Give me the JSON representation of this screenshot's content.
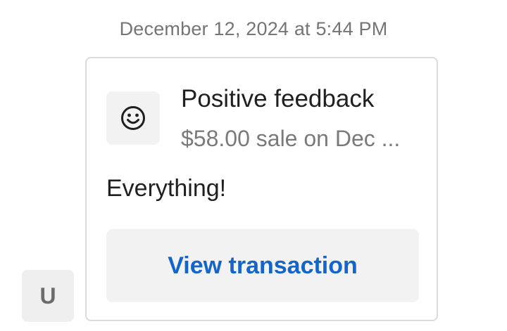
{
  "timestamp": "December 12, 2024 at 5:44 PM",
  "sender": {
    "avatar_initial": "U"
  },
  "card": {
    "icon": "smiley-face-icon",
    "title": "Positive feedback",
    "subtitle": "$58.00 sale on Dec ...",
    "message": "Everything!",
    "button_label": "View transaction"
  },
  "colors": {
    "accent": "#1565c8",
    "tile_background": "#f2f2f2",
    "border": "#dcdcdc"
  }
}
